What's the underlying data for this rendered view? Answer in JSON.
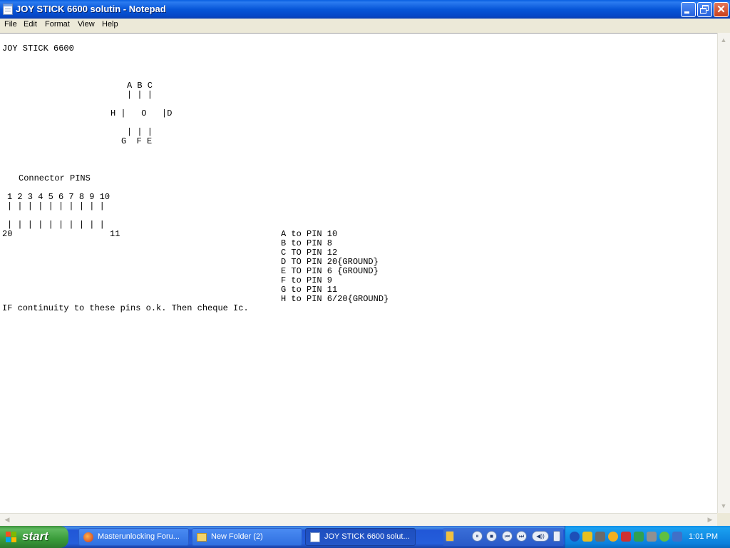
{
  "window": {
    "title": "JOY STICK 6600 solutin - Notepad",
    "close_glyph": "✕"
  },
  "menu": [
    "File",
    "Edit",
    "Format",
    "View",
    "Help"
  ],
  "document": {
    "heading": "JOY STICK 6600",
    "dir_top_labels": "A B C",
    "dir_top_bars": "| | |",
    "dir_middle": "H |   O   |D",
    "dir_bottom_bars": "| | |",
    "dir_bottom_labels": "G  F E",
    "connector_title": "Connector PINS",
    "pin_numbers": "1 2 3 4 5 6 7 8 9 10",
    "pin_bars_top": "| | | | | | | | | |",
    "pin_bars_bottom": "| | | | | | | | | |",
    "pin_left": "20",
    "pin_right": "11",
    "mapping": [
      "A to PIN 10",
      "B to PIN 8",
      "C TO PIN 12",
      "D TO PIN 20{GROUND}",
      "E TO PIN 6 {GROUND}",
      "F to PIN 9",
      "G to PIN 11",
      "H to PIN 6/20{GROUND}"
    ],
    "footer": "IF continuity to these pins o.k. Then cheque Ic."
  },
  "scrollbars": {
    "up": "▲",
    "down": "▼",
    "left": "◀",
    "right": "▶"
  },
  "taskbar": {
    "start_label": "start",
    "buttons": [
      {
        "label": "Masterunlocking Foru...",
        "icon": "firefox-icon"
      },
      {
        "label": "New Folder (2)",
        "icon": "folder-icon"
      },
      {
        "label": "JOY STICK 6600 solut...",
        "icon": "notepad-icon"
      }
    ],
    "media": [
      "⏸",
      "■",
      "⏮",
      "⏭",
      "◀))"
    ],
    "clock": "1:01 PM"
  },
  "colors": {
    "titlebar": "#0756d8",
    "taskbar": "#245edb",
    "start": "#3a9c3a",
    "tray": "#0c7fdc"
  }
}
